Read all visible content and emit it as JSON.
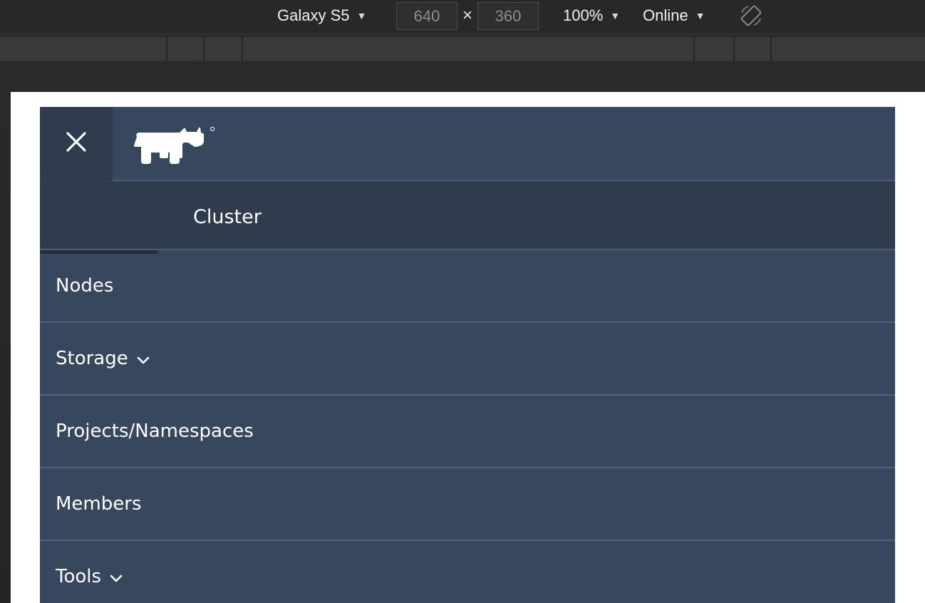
{
  "toolbar": {
    "device": "Galaxy S5",
    "width": "640",
    "height": "360",
    "dimension_separator": "×",
    "zoom": "100%",
    "network": "Online",
    "caret": "▼",
    "rotate_icon": "rotate-device-icon"
  },
  "app": {
    "close_icon": "close-icon",
    "logo_icon": "rancher-logo-icon",
    "tabs": [
      {
        "label": "Cluster",
        "active": true
      }
    ],
    "menu": [
      {
        "label": "Nodes",
        "has_submenu": false
      },
      {
        "label": "Storage",
        "has_submenu": true
      },
      {
        "label": "Projects/Namespaces",
        "has_submenu": false
      },
      {
        "label": "Members",
        "has_submenu": false
      },
      {
        "label": "Tools",
        "has_submenu": true
      }
    ]
  },
  "colors": {
    "app_bg": "#37475d",
    "header_dark": "#2f3c4d",
    "divider": "#50617a",
    "text": "#ffffff"
  }
}
